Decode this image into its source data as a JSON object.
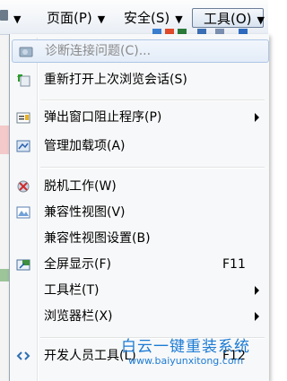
{
  "commandbar": {
    "page_label": "页面(P)",
    "safety_label": "安全(S)",
    "tools_label": "工具(O)",
    "arrow": "▼"
  },
  "menu": {
    "items": [
      {
        "label": "诊断连接问题(C)...",
        "icon": "diagnose-icon",
        "disabled": true
      },
      {
        "label": "重新打开上次浏览会话(S)",
        "icon": "reopen-session-icon"
      },
      {
        "label": "弹出窗口阻止程序(P)",
        "icon": "popup-blocker-icon",
        "submenu": true
      },
      {
        "label": "管理加载项(A)",
        "icon": "manage-addons-icon"
      },
      {
        "label": "脱机工作(W)",
        "icon": "work-offline-icon"
      },
      {
        "label": "兼容性视图(V)",
        "icon": "compatibility-view-icon"
      },
      {
        "label": "兼容性视图设置(B)",
        "icon": ""
      },
      {
        "label": "全屏显示(F)",
        "icon": "fullscreen-icon",
        "shortcut": "F11"
      },
      {
        "label": "工具栏(T)",
        "icon": "",
        "submenu": true
      },
      {
        "label": "浏览器栏(X)",
        "icon": "",
        "submenu": true
      },
      {
        "label": "开发人员工具(L)",
        "icon": "developer-tools-icon",
        "shortcut": "F12"
      }
    ]
  },
  "watermark": {
    "title": "白云一键重装系统",
    "url": "www.baiyunxitong.com"
  },
  "colors": {
    "menu_bg": "#f7f8f9",
    "highlight_border": "#aec6e6",
    "watermark": "#1c7bd4"
  }
}
